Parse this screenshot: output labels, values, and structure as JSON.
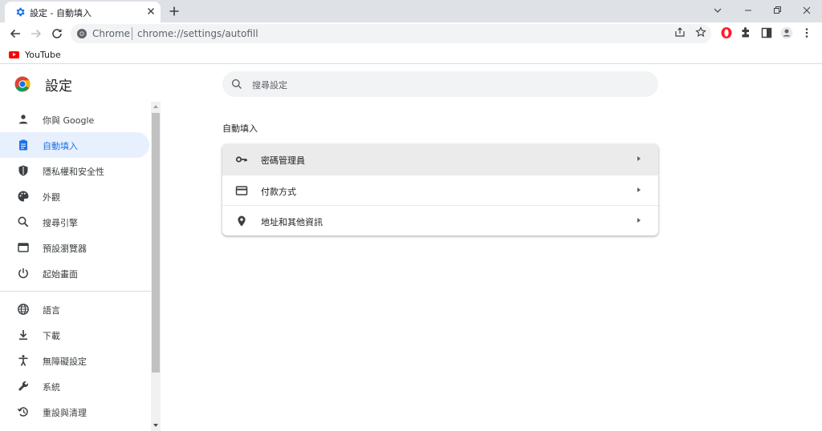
{
  "browser": {
    "tab": {
      "title": "設定 - 自動填入"
    },
    "address": {
      "scheme": "Chrome",
      "url": "chrome://settings/autofill"
    },
    "bookmarks": [
      {
        "label": "YouTube"
      }
    ]
  },
  "settings": {
    "app_title": "設定",
    "search": {
      "placeholder": "搜尋設定"
    },
    "sidebar": {
      "items": [
        {
          "label": "你與 Google",
          "icon": "person-icon"
        },
        {
          "label": "自動填入",
          "icon": "clipboard-icon",
          "active": true
        },
        {
          "label": "隱私權和安全性",
          "icon": "shield-icon"
        },
        {
          "label": "外觀",
          "icon": "palette-icon"
        },
        {
          "label": "搜尋引擎",
          "icon": "search-icon"
        },
        {
          "label": "預設瀏覽器",
          "icon": "browser-window-icon"
        },
        {
          "label": "起始畫面",
          "icon": "power-icon"
        },
        {
          "label": "語言",
          "icon": "globe-icon"
        },
        {
          "label": "下載",
          "icon": "download-icon"
        },
        {
          "label": "無障礙設定",
          "icon": "accessibility-icon"
        },
        {
          "label": "系統",
          "icon": "wrench-icon"
        },
        {
          "label": "重設與清理",
          "icon": "restore-icon"
        }
      ]
    },
    "section": {
      "title": "自動填入",
      "rows": [
        {
          "label": "密碼管理員",
          "icon": "key-icon"
        },
        {
          "label": "付款方式",
          "icon": "credit-card-icon"
        },
        {
          "label": "地址和其他資訊",
          "icon": "location-pin-icon"
        }
      ]
    }
  },
  "colors": {
    "accent": "#1a73e8",
    "active_bg": "#e8f0fe",
    "tabstrip": "#dee1e6"
  }
}
